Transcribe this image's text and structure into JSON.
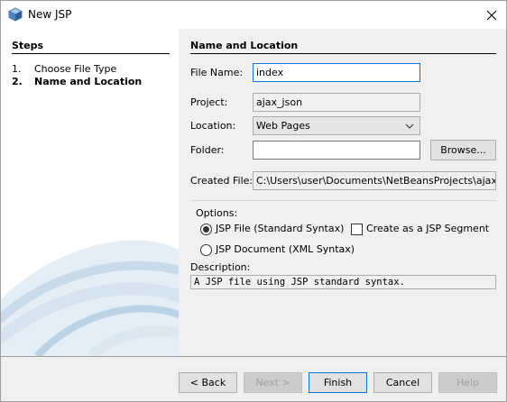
{
  "window": {
    "title": "New JSP"
  },
  "steps": {
    "heading": "Steps",
    "items": [
      {
        "num": "1.",
        "label": "Choose File Type",
        "active": false
      },
      {
        "num": "2.",
        "label": "Name and Location",
        "active": true
      }
    ]
  },
  "main": {
    "section_title": "Name and Location",
    "file_name": {
      "label": "File Name:",
      "value": "index"
    },
    "project": {
      "label": "Project:",
      "value": "ajax_json"
    },
    "location": {
      "label": "Location:",
      "value": "Web Pages"
    },
    "folder": {
      "label": "Folder:",
      "value": "",
      "browse_label": "Browse..."
    },
    "created_file": {
      "label": "Created File:",
      "value": "C:\\Users\\user\\Documents\\NetBeansProjects\\ajax_json"
    },
    "options": {
      "label": "Options:",
      "jsp_file": {
        "label": "JSP File (Standard Syntax)",
        "checked": true
      },
      "jsp_segment": {
        "label": "Create as a JSP Segment",
        "checked": false
      },
      "jsp_document": {
        "label": "JSP Document (XML Syntax)",
        "checked": false
      }
    },
    "description": {
      "label": "Description:",
      "text": "A JSP file using JSP standard syntax."
    }
  },
  "footer": {
    "back_label": "< Back",
    "next_label": "Next >",
    "finish_label": "Finish",
    "cancel_label": "Cancel",
    "help_label": "Help"
  },
  "icons": {
    "app": "netbeans-cube-icon",
    "close": "close-icon",
    "dropdown": "chevron-down-icon"
  },
  "colors": {
    "focus_blue": "#0078d7",
    "swoosh_blue": "#c9dbea"
  }
}
